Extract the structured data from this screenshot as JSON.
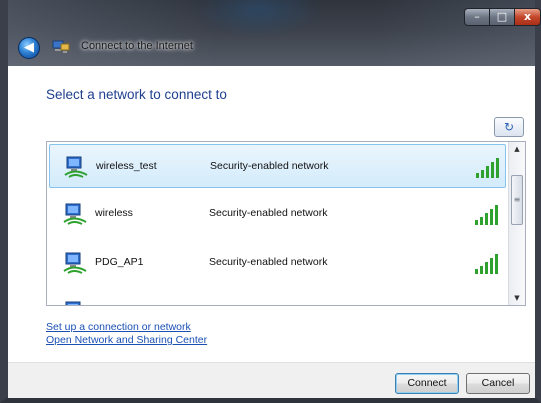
{
  "window": {
    "title": "Connect to the Internet",
    "controls": {
      "minimize": "–",
      "maximize": "□",
      "close": "x"
    },
    "back_glyph": "◀"
  },
  "heading": "Select a network to connect to",
  "refresh_glyph": "↻",
  "networks": [
    {
      "ssid": "wireless_test",
      "security": "Security-enabled network",
      "signal_bars": 5,
      "selected": true
    },
    {
      "ssid": "wireless",
      "security": "Security-enabled network",
      "signal_bars": 5,
      "selected": false
    },
    {
      "ssid": "PDG_AP1",
      "security": "Security-enabled network",
      "signal_bars": 5,
      "selected": false
    }
  ],
  "links": {
    "setup": "Set up a connection or network",
    "sharing_center": "Open Network and Sharing Center"
  },
  "buttons": {
    "connect": "Connect",
    "cancel": "Cancel"
  },
  "colors": {
    "heading": "#1f3f8f",
    "link": "#1a4fb4",
    "signal": "#2fa12f"
  }
}
